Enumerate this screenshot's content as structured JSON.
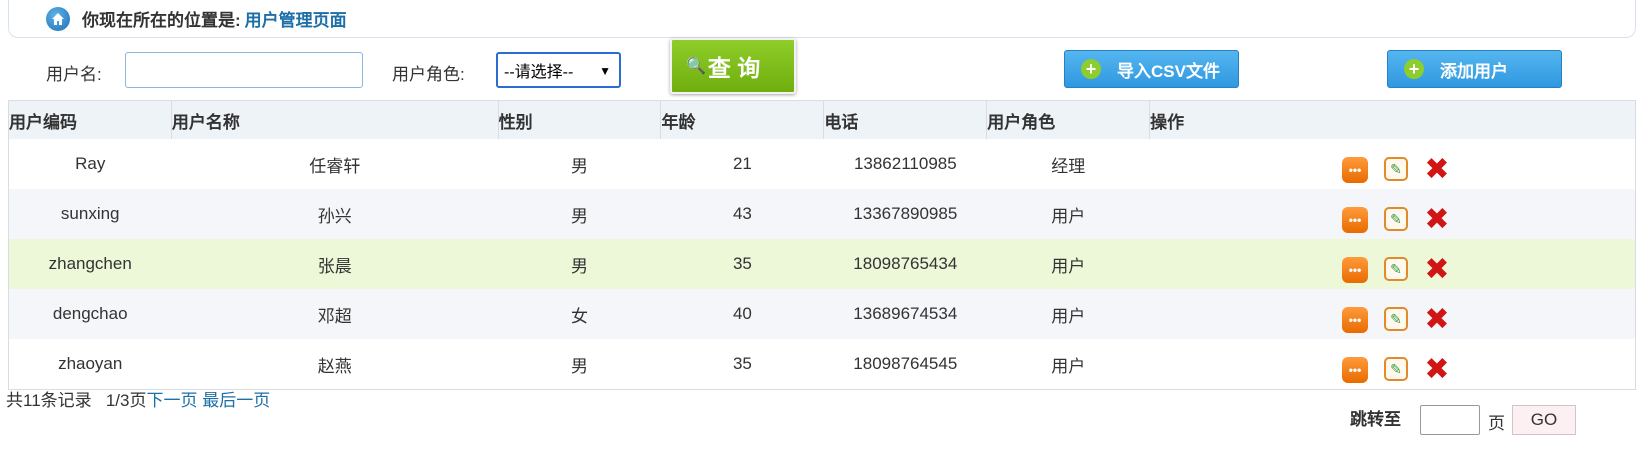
{
  "breadcrumb": {
    "label": "你现在所在的位置是:",
    "page": "用户管理页面"
  },
  "search": {
    "username_label": "用户名:",
    "username_value": "",
    "role_label": "用户角色:",
    "role_selected": "--请选择--",
    "query_button": "查 询",
    "import_button": "导入CSV文件",
    "add_button": "添加用户"
  },
  "table": {
    "headers": [
      "用户编码",
      "用户名称",
      "性别",
      "年龄",
      "电话",
      "用户角色",
      "操作"
    ],
    "rows": [
      {
        "code": "Ray",
        "name": "任睿轩",
        "gender": "男",
        "age": "21",
        "phone": "13862110985",
        "role": "经理"
      },
      {
        "code": "sunxing",
        "name": "孙兴",
        "gender": "男",
        "age": "43",
        "phone": "13367890985",
        "role": "用户"
      },
      {
        "code": "zhangchen",
        "name": "张晨",
        "gender": "男",
        "age": "35",
        "phone": "18098765434",
        "role": "用户"
      },
      {
        "code": "dengchao",
        "name": "邓超",
        "gender": "女",
        "age": "40",
        "phone": "13689674534",
        "role": "用户"
      },
      {
        "code": "zhaoyan",
        "name": "赵燕",
        "gender": "男",
        "age": "35",
        "phone": "18098764545",
        "role": "用户"
      }
    ]
  },
  "pager": {
    "total": "共11条记录",
    "page_info": "1/3页",
    "next": "下一页",
    "last": "最后一页",
    "jump_label": "跳转至",
    "jump_value": "",
    "page_unit": "页",
    "go": "GO"
  },
  "colors": {
    "accent_green": "#7cbf1b",
    "accent_blue": "#3aa0e6",
    "link": "#1d6fa8",
    "highlight_row": "#ecf8d8"
  },
  "icons": [
    "home-icon",
    "magnifier-icon",
    "plus-icon",
    "view-icon",
    "edit-icon",
    "delete-icon"
  ]
}
